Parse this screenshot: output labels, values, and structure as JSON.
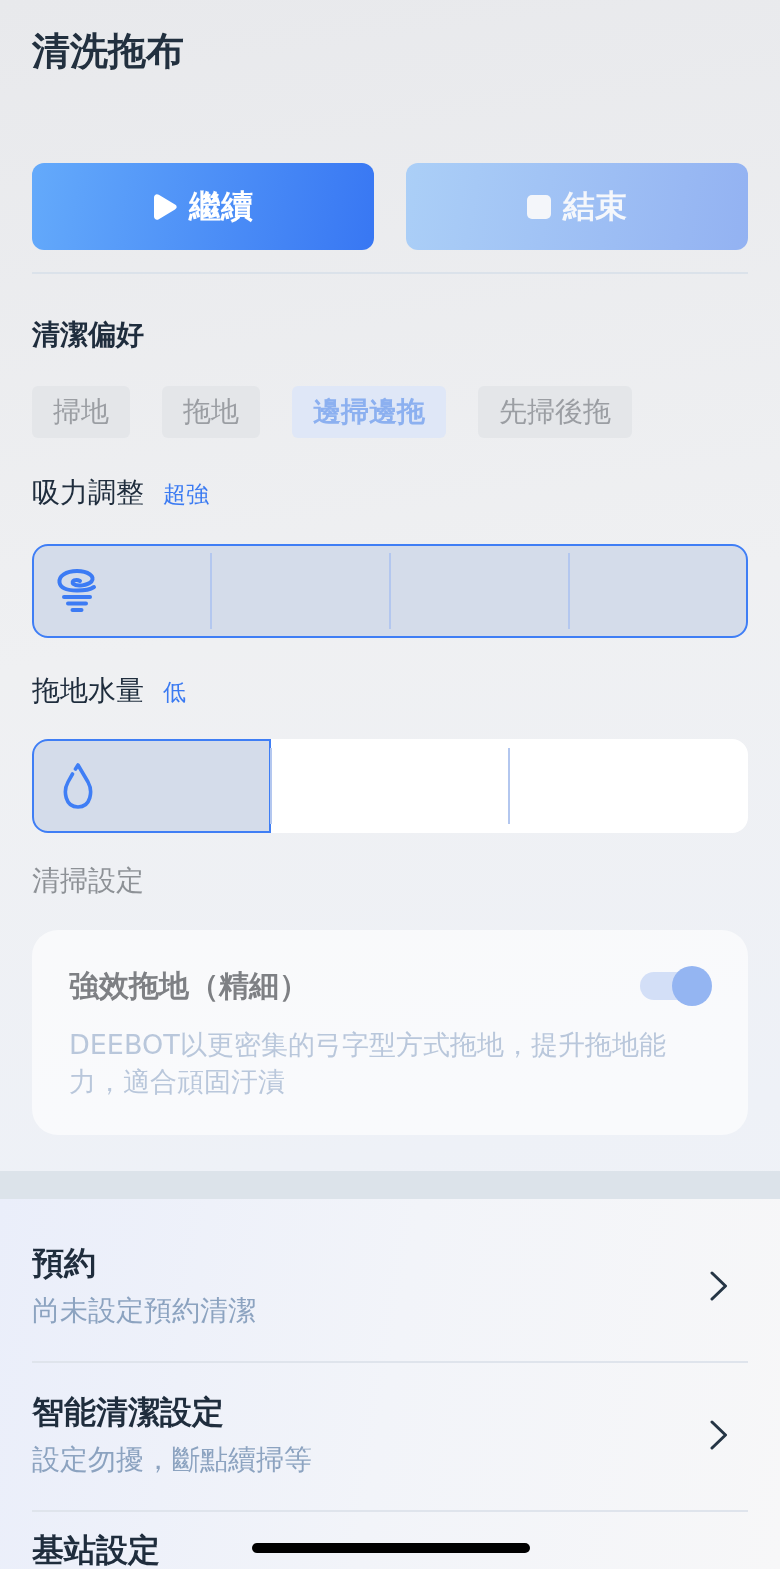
{
  "title": "清洗拖布",
  "actions": [
    {
      "kind": "play",
      "label": "繼續"
    },
    {
      "kind": "stop",
      "label": "結束"
    }
  ],
  "preference": {
    "heading": "清潔偏好",
    "options": [
      {
        "label": "掃地",
        "selected": false
      },
      {
        "label": "拖地",
        "selected": false
      },
      {
        "label": "邊掃邊拖",
        "selected": true
      },
      {
        "label": "先掃後拖",
        "selected": false
      }
    ]
  },
  "suction": {
    "label": "吸力調整",
    "value": "超強",
    "level": 1
  },
  "water": {
    "label": "拖地水量",
    "value": "低",
    "level": 0.3333
  },
  "settings": {
    "heading": "清掃設定",
    "card": {
      "title": "強效拖地（精細）",
      "description": "DEEBOT以更密集的弓字型方式拖地，提升拖地能力，適合頑固汙漬",
      "on": true,
      "disabled": true
    }
  },
  "menu": [
    {
      "title": "預約",
      "subtitle": "尚未設定預約清潔",
      "arrow": true
    },
    {
      "title": "智能清潔設定",
      "subtitle": "設定勿擾，斷點續掃等",
      "arrow": true
    },
    {
      "title": "基站設定",
      "arrow": false
    }
  ]
}
